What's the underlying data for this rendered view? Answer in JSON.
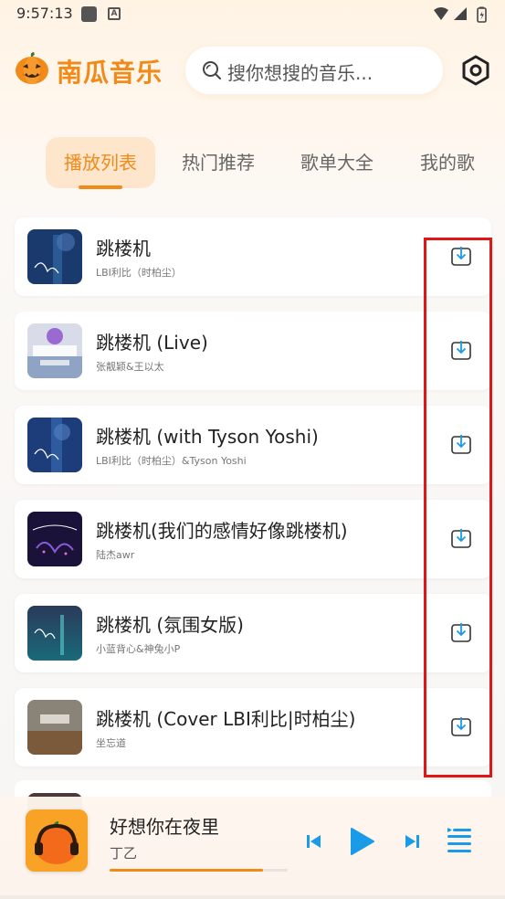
{
  "status_bar": {
    "time": "9:57:13",
    "app_badge": "A"
  },
  "header": {
    "app_name": "南瓜音乐",
    "search_placeholder": "搜你想搜的音乐..."
  },
  "tabs": [
    {
      "label": "播放列表",
      "active": true
    },
    {
      "label": "热门推荐",
      "active": false
    },
    {
      "label": "歌单大全",
      "active": false
    },
    {
      "label": "我的歌",
      "active": false
    }
  ],
  "songs": [
    {
      "title": "跳楼机",
      "artist": "LBI利比（时柏尘）"
    },
    {
      "title": "跳楼机 (Live)",
      "artist": "张靓颖&王以太"
    },
    {
      "title": "跳楼机 (with Tyson Yoshi)",
      "artist": "LBI利比（时柏尘）&Tyson Yoshi"
    },
    {
      "title": "跳楼机(我们的感情好像跳楼机)",
      "artist": "陆杰awr"
    },
    {
      "title": "跳楼机 (氛围女版)",
      "artist": "小蓝背心&神兔小P"
    },
    {
      "title": "跳楼机 (Cover LBI利比|时柏尘)",
      "artist": "坐忘道"
    }
  ],
  "player": {
    "title": "好想你在夜里",
    "artist": "丁乙",
    "progress": 0.86
  },
  "colors": {
    "accent": "#f28a1a",
    "control_blue": "#1a9be8",
    "highlight": "#e01515"
  }
}
